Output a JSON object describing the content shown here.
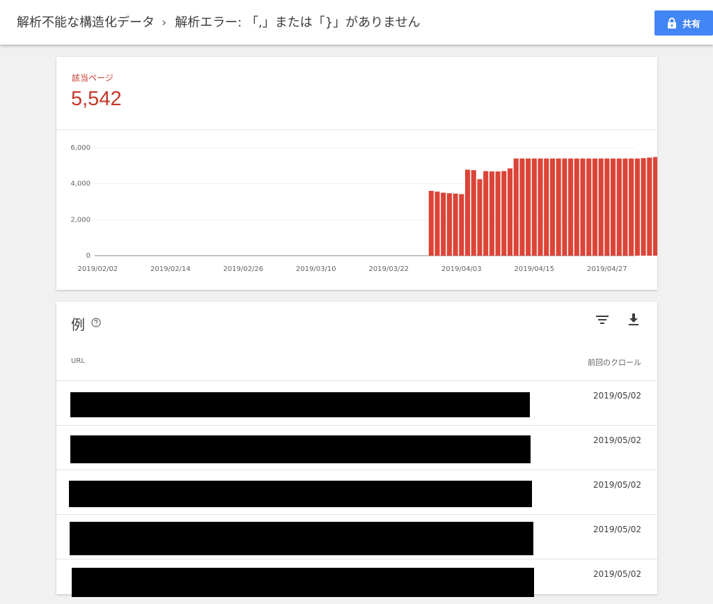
{
  "header": {
    "breadcrumb_parent": "解析不能な構造化データ",
    "breadcrumb_separator": "›",
    "breadcrumb_current": "解析エラー: 「,」または「}」がありません",
    "share_label": "共有",
    "share_icon": "lock-icon"
  },
  "summary": {
    "label": "該当ページ",
    "value": "5,542",
    "accent_color": "#db4437"
  },
  "chart_data": {
    "type": "bar",
    "title": "",
    "xlabel": "",
    "ylabel": "",
    "ylim": [
      0,
      6000
    ],
    "grid": true,
    "yticks": [
      "0",
      "2,000",
      "4,000",
      "6,000"
    ],
    "xticks": [
      "2019/02/02",
      "2019/02/14",
      "2019/02/26",
      "2019/03/10",
      "2019/03/22",
      "2019/04/03",
      "2019/04/15",
      "2019/04/27"
    ],
    "categories": [
      "2019/02/02",
      "2019/02/03",
      "2019/02/04",
      "2019/02/05",
      "2019/02/06",
      "2019/02/07",
      "2019/02/08",
      "2019/02/09",
      "2019/02/10",
      "2019/02/11",
      "2019/02/12",
      "2019/02/13",
      "2019/02/14",
      "2019/02/15",
      "2019/02/16",
      "2019/02/17",
      "2019/02/18",
      "2019/02/19",
      "2019/02/20",
      "2019/02/21",
      "2019/02/22",
      "2019/02/23",
      "2019/02/24",
      "2019/02/25",
      "2019/02/26",
      "2019/02/27",
      "2019/02/28",
      "2019/03/01",
      "2019/03/02",
      "2019/03/03",
      "2019/03/04",
      "2019/03/05",
      "2019/03/06",
      "2019/03/07",
      "2019/03/08",
      "2019/03/09",
      "2019/03/10",
      "2019/03/11",
      "2019/03/12",
      "2019/03/13",
      "2019/03/14",
      "2019/03/15",
      "2019/03/16",
      "2019/03/17",
      "2019/03/18",
      "2019/03/19",
      "2019/03/20",
      "2019/03/21",
      "2019/03/22",
      "2019/03/23",
      "2019/03/24",
      "2019/03/25",
      "2019/03/26",
      "2019/03/27",
      "2019/03/28",
      "2019/03/29",
      "2019/03/30",
      "2019/03/31",
      "2019/04/01",
      "2019/04/02",
      "2019/04/03",
      "2019/04/04",
      "2019/04/05",
      "2019/04/06",
      "2019/04/07",
      "2019/04/08",
      "2019/04/09",
      "2019/04/10",
      "2019/04/11",
      "2019/04/12",
      "2019/04/13",
      "2019/04/14",
      "2019/04/15",
      "2019/04/16",
      "2019/04/17",
      "2019/04/18",
      "2019/04/19",
      "2019/04/20",
      "2019/04/21",
      "2019/04/22",
      "2019/04/23",
      "2019/04/24",
      "2019/04/25",
      "2019/04/26",
      "2019/04/27",
      "2019/04/28",
      "2019/04/29",
      "2019/04/30",
      "2019/05/01"
    ],
    "series": [
      {
        "color": "#db4437",
        "values": [
          0,
          0,
          0,
          0,
          0,
          0,
          0,
          0,
          0,
          0,
          0,
          0,
          0,
          0,
          0,
          0,
          0,
          0,
          0,
          0,
          0,
          0,
          0,
          0,
          0,
          0,
          0,
          0,
          0,
          0,
          0,
          0,
          0,
          0,
          0,
          0,
          0,
          0,
          0,
          0,
          0,
          0,
          0,
          0,
          0,
          0,
          0,
          0,
          0,
          0,
          0,
          0,
          0,
          0,
          0,
          3600,
          3560,
          3500,
          3470,
          3450,
          3420,
          4780,
          4750,
          4250,
          4700,
          4680,
          4680,
          4700,
          4850,
          5400,
          5400,
          5400,
          5400,
          5400,
          5400,
          5400,
          5400,
          5400,
          5400,
          5400,
          5400,
          5400,
          5400,
          5400,
          5400,
          5400,
          5400,
          5400,
          5400,
          5400,
          5420,
          5450,
          5480,
          5500,
          5542
        ]
      }
    ]
  },
  "examples": {
    "title": "例",
    "help_icon": "help-circle-icon",
    "filter_icon": "filter-icon",
    "download_icon": "download-icon",
    "col_url": "URL",
    "col_last_crawl": "前回のクロール",
    "rows": [
      {
        "url": "",
        "date": "2019/05/02"
      },
      {
        "url": "",
        "date": "2019/05/02"
      },
      {
        "url": "",
        "date": "2019/05/02"
      },
      {
        "url": "",
        "date": "2019/05/02"
      },
      {
        "url": "",
        "date": "2019/05/02"
      }
    ]
  }
}
